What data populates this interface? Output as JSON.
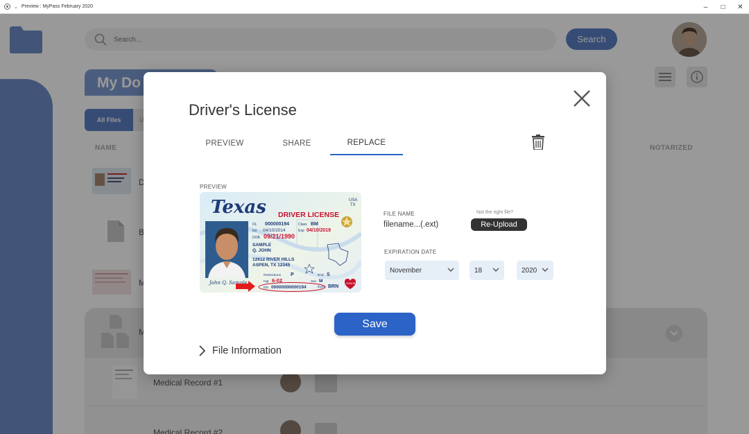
{
  "window": {
    "title": "Preview : MyPass February 2020",
    "controls": [
      "minimize-icon",
      "maximize-icon",
      "close-icon"
    ]
  },
  "background": {
    "search_placeholder": "Search...",
    "search_button": "Search",
    "section_title": "My Do",
    "tab_all": "All Files",
    "tab_other": "U",
    "col_name": "NAME",
    "col_notarized": "NOTARIZED",
    "row_letters": [
      "D",
      "B",
      "M"
    ],
    "group_letter": "M",
    "records": [
      "Medical Record #1",
      "Medical Record #2"
    ]
  },
  "modal": {
    "title": "Driver's License",
    "tabs": [
      {
        "label": "PREVIEW",
        "active": false
      },
      {
        "label": "SHARE",
        "active": false
      },
      {
        "label": "REPLACE",
        "active": true
      }
    ],
    "preview_label": "PREVIEW",
    "license": {
      "state": "Texas",
      "usa": "USA",
      "tx": "TX",
      "type": "DRIVER LICENSE",
      "dl_label": "DL",
      "dl": "000000194",
      "class_label": "Class",
      "class": "BM",
      "iss_label": "Iss",
      "iss": "04/10/2014",
      "exp_label": "Exp",
      "exp": "04/10/2018",
      "dob_label": "DOB",
      "dob": "09/21/1990",
      "name_last": "SAMPLE",
      "name_first": "Q. JOHN",
      "address1": "12612 RIVER HILLS",
      "address2": "ASPEN, TX 12345",
      "restrictions_label": "Restrictions",
      "restrictions": "P",
      "end_label": "End",
      "end": "S",
      "sex_label": "Sex",
      "sex": "M",
      "hgt_label": "Hgt",
      "hgt": "6-02",
      "eyes_label": "Eyes",
      "eyes": "BRN",
      "dd_label": "DD",
      "dd": "00000000000194",
      "signature": "John Q. Sample",
      "donor": "DONOR"
    },
    "file_name_label": "FILE NAME",
    "file_name": "filename...(.ext)",
    "not_right_file": "Not the right file?",
    "reupload_button": "Re-Upload",
    "expiration_label": "EXPIRATION DATE",
    "expiration": {
      "month": "November",
      "day": "18",
      "year": "2020"
    },
    "save_button": "Save",
    "file_information": "File Information"
  },
  "colors": {
    "primary": "#2b63c6",
    "accent_bg": "#5c7fc4",
    "select_bg": "#e6eef7",
    "reupload_bg": "#333333",
    "license_red": "#c8102e",
    "license_navy": "#1e3a78"
  }
}
